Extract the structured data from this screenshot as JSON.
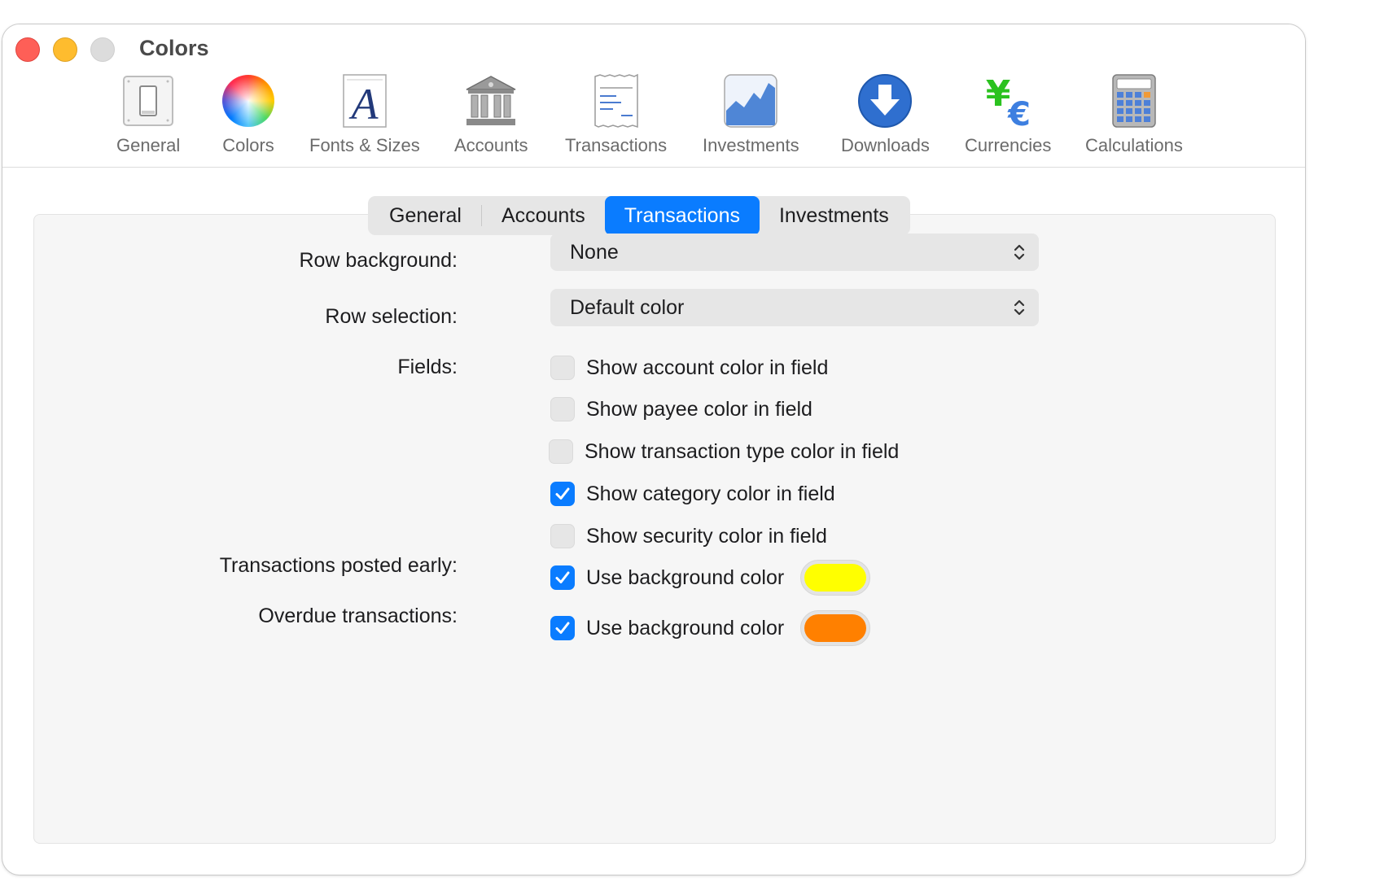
{
  "window": {
    "title": "Colors"
  },
  "toolbar": {
    "items": [
      {
        "label": "General",
        "icon": "switch-icon"
      },
      {
        "label": "Colors",
        "icon": "color-wheel-icon"
      },
      {
        "label": "Fonts & Sizes",
        "icon": "font-icon"
      },
      {
        "label": "Accounts",
        "icon": "bank-icon"
      },
      {
        "label": "Transactions",
        "icon": "receipt-icon"
      },
      {
        "label": "Investments",
        "icon": "chart-icon"
      },
      {
        "label": "Downloads",
        "icon": "download-icon"
      },
      {
        "label": "Currencies",
        "icon": "currency-icon"
      },
      {
        "label": "Calculations",
        "icon": "calculator-icon"
      }
    ],
    "selected": "Colors"
  },
  "tabs": {
    "items": [
      "General",
      "Accounts",
      "Transactions",
      "Investments"
    ],
    "selected": "Transactions"
  },
  "form": {
    "row_background": {
      "label": "Row background:",
      "value": "None"
    },
    "row_selection": {
      "label": "Row selection:",
      "value": "Default color"
    },
    "fields": {
      "label": "Fields:",
      "options": [
        {
          "label": "Show account color in field",
          "checked": false
        },
        {
          "label": "Show payee color in field",
          "checked": false
        },
        {
          "label": "Show transaction type color in field",
          "checked": false
        },
        {
          "label": "Show category color in field",
          "checked": true
        },
        {
          "label": "Show security color in field",
          "checked": false
        }
      ]
    },
    "posted_early": {
      "label": "Transactions posted early:",
      "option": "Use background color",
      "checked": true,
      "color": "#ffff00"
    },
    "overdue": {
      "label": "Overdue transactions:",
      "option": "Use background color",
      "checked": true,
      "color": "#ff8000"
    }
  },
  "colors": {
    "accent": "#0a7cff"
  }
}
